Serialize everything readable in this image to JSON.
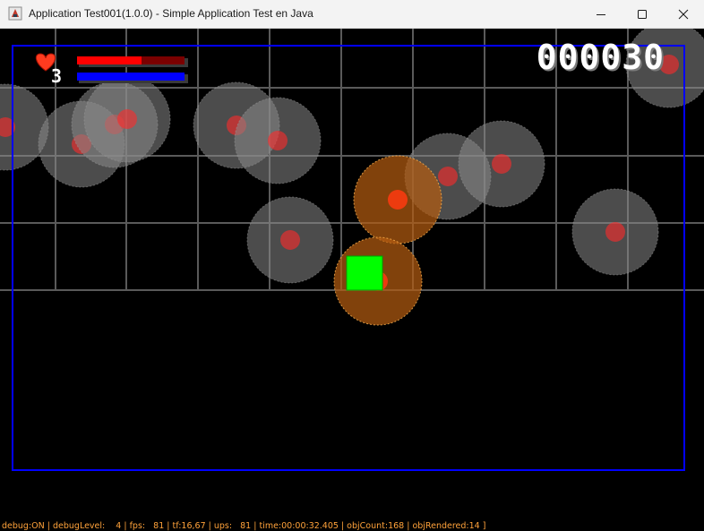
{
  "window": {
    "title": "Application Test001(1.0.0) - Simple Application Test en Java",
    "minimize_icon": "minimize-icon",
    "maximize_icon": "maximize-icon",
    "close_icon": "close-icon"
  },
  "hud": {
    "lives": "3",
    "heart_icon": "heart-icon",
    "health_ratio": 0.6,
    "energy_ratio": 1.0,
    "score": "000030",
    "colors": {
      "health": "#ff0000",
      "health_back": "#7a0000",
      "energy": "#0000ff",
      "frame": "#0000ff"
    }
  },
  "player": {
    "color": "#00ff00"
  },
  "debug": {
    "text": "debug:ON | debugLevel:    4 | fps:   81 | tf:16,67 | ups:   81 | time:00:00:32.405 | objCount:168 | objRendered:14 ]"
  }
}
